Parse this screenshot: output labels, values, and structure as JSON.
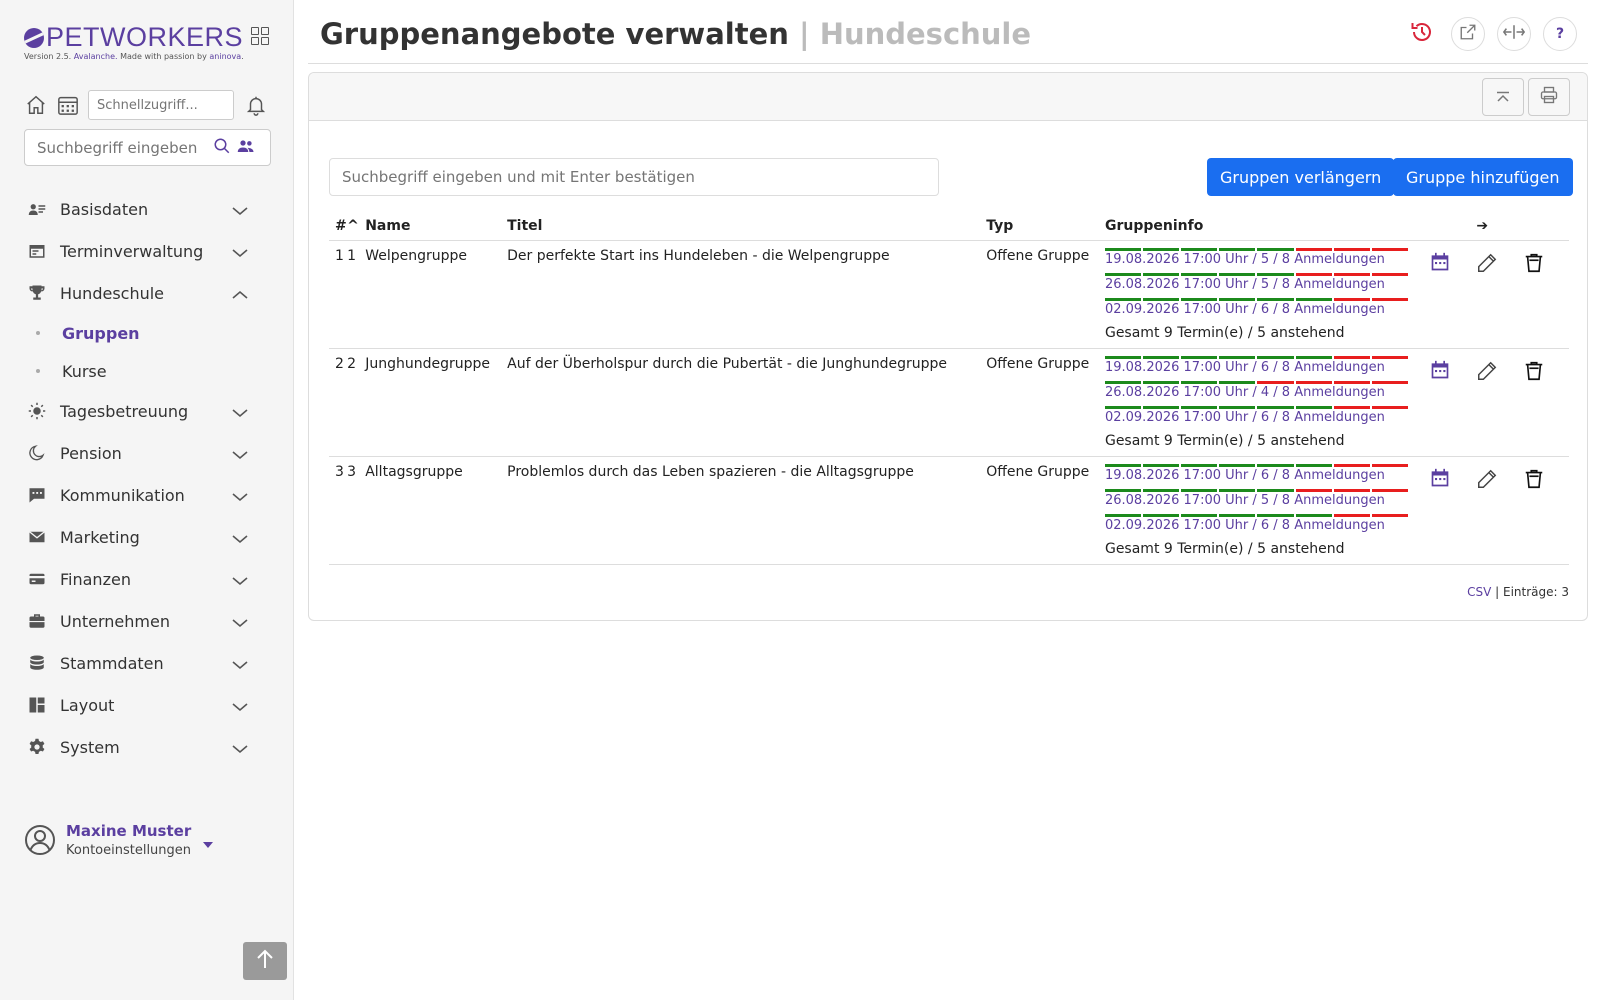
{
  "app": {
    "brand": "PETWORKERS",
    "version_prefix": "Version 2.5.",
    "version_name": "Avalanche.",
    "version_middle": "Made with passion by",
    "version_company": "aninova",
    "version_suffix": "."
  },
  "sidebar": {
    "quick_placeholder": "Schnellzugriff...",
    "search_placeholder": "Suchbegriff eingeben",
    "nav": [
      {
        "label": "Basisdaten",
        "icon": "contact-card-icon"
      },
      {
        "label": "Terminverwaltung",
        "icon": "calendar-board-icon"
      },
      {
        "label": "Hundeschule",
        "icon": "trophy-icon",
        "expanded": true
      },
      {
        "label": "Tagesbetreuung",
        "icon": "sun-icon"
      },
      {
        "label": "Pension",
        "icon": "moon-icon"
      },
      {
        "label": "Kommunikation",
        "icon": "chat-icon"
      },
      {
        "label": "Marketing",
        "icon": "mail-icon"
      },
      {
        "label": "Finanzen",
        "icon": "credit-card-icon"
      },
      {
        "label": "Unternehmen",
        "icon": "briefcase-icon"
      },
      {
        "label": "Stammdaten",
        "icon": "database-icon"
      },
      {
        "label": "Layout",
        "icon": "layout-icon"
      },
      {
        "label": "System",
        "icon": "gear-icon"
      }
    ],
    "sub_items": [
      {
        "label": "Gruppen",
        "active": true
      },
      {
        "label": "Kurse",
        "active": false
      }
    ],
    "user": {
      "name": "Maxine Muster",
      "subtitle": "Kontoeinstellungen"
    }
  },
  "header": {
    "title": "Gruppenangebote verwalten",
    "separator": " | ",
    "subtitle": "Hundeschule",
    "help_label": "?"
  },
  "toolbar": {
    "search_placeholder": "Suchbegriff eingeben und mit Enter bestätigen",
    "extend_label": "Gruppen verlängern",
    "add_label": "Gruppe hinzufügen"
  },
  "table": {
    "columns": {
      "hash": "#",
      "sort": "^",
      "name": "Name",
      "title": "Titel",
      "type": "Typ",
      "info": "Gruppeninfo",
      "arrow": "➔"
    },
    "rows": [
      {
        "idx": "1",
        "order": "1",
        "name": "Welpengruppe",
        "title": "Der perfekte Start ins Hundeleben - die Welpengruppe",
        "type": "Offene Gruppe",
        "termine": [
          {
            "label": "19.08.2026 17:00 Uhr / 5 / 8 Anmeldungen",
            "booked": 5,
            "capacity": 8
          },
          {
            "label": "26.08.2026 17:00 Uhr / 5 / 8 Anmeldungen",
            "booked": 5,
            "capacity": 8
          },
          {
            "label": "02.09.2026 17:00 Uhr / 6 / 8 Anmeldungen",
            "booked": 6,
            "capacity": 8
          }
        ],
        "summary": "Gesamt 9 Termin(e) / 5 anstehend"
      },
      {
        "idx": "2",
        "order": "2",
        "name": "Junghundegruppe",
        "title": "Auf der Überholspur durch die Pubertät - die Junghundegruppe",
        "type": "Offene Gruppe",
        "termine": [
          {
            "label": "19.08.2026 17:00 Uhr / 6 / 8 Anmeldungen",
            "booked": 6,
            "capacity": 8
          },
          {
            "label": "26.08.2026 17:00 Uhr / 4 / 8 Anmeldungen",
            "booked": 4,
            "capacity": 8
          },
          {
            "label": "02.09.2026 17:00 Uhr / 6 / 8 Anmeldungen",
            "booked": 6,
            "capacity": 8
          }
        ],
        "summary": "Gesamt 9 Termin(e) / 5 anstehend"
      },
      {
        "idx": "3",
        "order": "3",
        "name": "Alltagsgruppe",
        "title": "Problemlos durch das Leben spazieren - die Alltagsgruppe",
        "type": "Offene Gruppe",
        "termine": [
          {
            "label": "19.08.2026 17:00 Uhr / 6 / 8 Anmeldungen",
            "booked": 6,
            "capacity": 8
          },
          {
            "label": "26.08.2026 17:00 Uhr / 5 / 8 Anmeldungen",
            "booked": 5,
            "capacity": 8
          },
          {
            "label": "02.09.2026 17:00 Uhr / 6 / 8 Anmeldungen",
            "booked": 6,
            "capacity": 8
          }
        ],
        "summary": "Gesamt 9 Termin(e) / 5 anstehend"
      }
    ]
  },
  "footer": {
    "csv_label": "CSV",
    "separator": " | ",
    "entries_label": "Einträge: 3"
  },
  "colors": {
    "brand": "#5b3fa0",
    "primary_button": "#1a6ef0",
    "booked": "#1c8a1c",
    "free": "#e81e1e",
    "history_icon": "#d9263b"
  }
}
